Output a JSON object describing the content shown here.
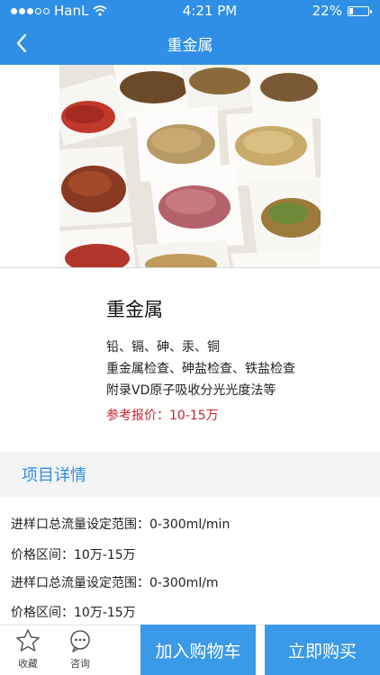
{
  "status_bar": {
    "carrier": "HanL",
    "time": "4:21 PM",
    "battery": "22%",
    "battery_level": 0.22
  },
  "nav": {
    "title": "重金属",
    "back_icon": "chevron-left-icon"
  },
  "product": {
    "title": "重金属",
    "line1": "铅、镉、砷、汞、铜",
    "line2": "重金属检查、砷盐检查、铁盐检查",
    "line3": "附录VD原子吸收分光光度法等",
    "price": "参考报价：10-15万"
  },
  "section": {
    "title": "项目详情"
  },
  "details": [
    "进样口总流量设定范围：0-300ml/min",
    "价格区间：10万-15万",
    "进样口总流量设定范围：0-300ml/m",
    "价格区间：10万-15万"
  ],
  "bottom_bar": {
    "favorite_label": "收藏",
    "consult_label": "咨询",
    "cart_label": "加入购物车",
    "buy_label": "立即购买"
  },
  "colors": {
    "primary": "#2f8fe6",
    "button": "#3a9ae8",
    "price": "#c8232d"
  }
}
